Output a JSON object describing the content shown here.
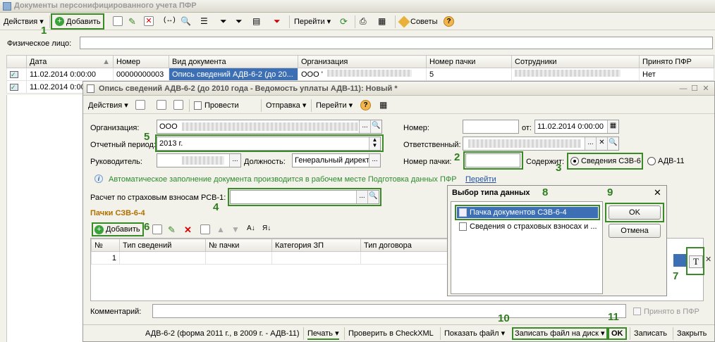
{
  "app": {
    "title": "Документы персонифицированного учета ПФР"
  },
  "main_toolbar": {
    "actions": "Действия",
    "add": "Добавить",
    "goto": "Перейти",
    "tips": "Советы"
  },
  "filter": {
    "label": "Физическое лицо:"
  },
  "main_table": {
    "columns": [
      "Дата",
      "Номер",
      "Вид документа",
      "Организация",
      "Номер пачки",
      "Сотрудники",
      "Принято ПФР"
    ],
    "rows": [
      {
        "date": "11.02.2014 0:00:00",
        "number": "00000000003",
        "doc_type": "Опись сведений АДВ-6-2 (до 20...",
        "org": "ООО '",
        "batch": "5",
        "accepted": "Нет"
      },
      {
        "date": "11.02.2014 0:00:00"
      }
    ]
  },
  "doc_window": {
    "title": "Опись сведений АДВ-6-2 (до 2010 года - Ведомость уплаты АДВ-11): Новый *",
    "toolbar": {
      "actions": "Действия",
      "post": "Провести",
      "send": "Отправка",
      "goto": "Перейти"
    },
    "org_label": "Организация:",
    "org_value": "ООО",
    "number_label": "Номер:",
    "from_label": "от:",
    "date_value": "11.02.2014  0:00:00",
    "period_label": "Отчетный период:",
    "period_value": "2013 г.",
    "responsible_label": "Ответственный:",
    "head_label": "Руководитель:",
    "position_label": "Должность:",
    "position_value": "Генеральный директ",
    "batch_label": "Номер пачки:",
    "contains_label": "Содержит:",
    "opt_szv": "Сведения СЗВ-6",
    "opt_adv": "АДВ-11",
    "info_text": "Автоматическое заполнение документа производится в рабочем месте Подготовка данных ПФР",
    "info_link": "Перейти",
    "calc_label": "Расчет по страховым взносам РСВ-1:",
    "section_title": "Пачки СЗВ-6-4",
    "add": "Добавить",
    "grid_columns": [
      "№",
      "Тип сведений",
      "№ пачки",
      "Категория ЗП",
      "Тип договора"
    ],
    "grid_row_num": "1",
    "type_btn": "T",
    "comment_label": "Комментарий:",
    "accepted_label": "Принято в ПФР",
    "footer": {
      "form": "АДВ-6-2 (форма 2011 г., в 2009 г. - АДВ-11)",
      "print": "Печать",
      "check": "Проверить в CheckXML",
      "show": "Показать файл",
      "write_disk": "Записать файл на диск",
      "ok": "OK",
      "save": "Записать",
      "close": "Закрыть"
    }
  },
  "popup": {
    "title": "Выбор типа данных",
    "items": [
      "Пачка документов СЗВ-6-4",
      "Сведения о страховых взносах и ..."
    ],
    "ok": "OK",
    "cancel": "Отмена"
  },
  "markers": [
    "1",
    "2",
    "3",
    "4",
    "5",
    "6",
    "7",
    "8",
    "9",
    "10",
    "11"
  ]
}
